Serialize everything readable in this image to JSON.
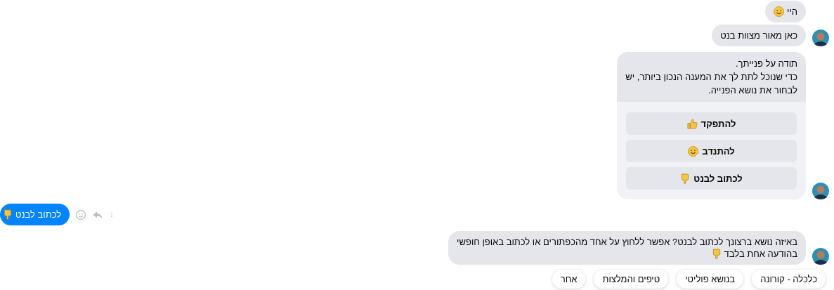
{
  "messages": [
    {
      "kind": "bot-text",
      "lines": [
        {
          "text": "היי",
          "kind": "smile"
        }
      ],
      "avatar": false
    },
    {
      "kind": "bot-text",
      "lines": [
        {
          "text": "כאן מאור מצוות בנט",
          "kind": "plain"
        }
      ],
      "avatar": true
    },
    {
      "kind": "bot-card",
      "paragraphs": [
        "תודה על פנייתך.",
        "כדי שנוכל לתת לך את המענה הנכון ביותר, יש לבחור את נושא הפנייה."
      ],
      "buttons": [
        {
          "label": "להתפקד",
          "kind": "thumbs-up"
        },
        {
          "label": "להתנדב",
          "kind": "smile"
        },
        {
          "label": "לכתוב לבנט",
          "kind": "point-down"
        }
      ],
      "avatar": true
    },
    {
      "kind": "user",
      "lines": [
        {
          "text": "לכתוב לבנט",
          "kind": "point-down"
        }
      ]
    },
    {
      "kind": "bot-text",
      "lines": [
        {
          "text": "באיזה נושא ברצונך לכתוב לבנט? אפשר ללחוץ על אחד מהכפתורים או לכתוב באופן חופשי",
          "kind": "plain"
        },
        {
          "text": "בהודעה אחת בלבד",
          "kind": "point-down"
        }
      ],
      "avatar": true
    }
  ],
  "quick_replies": [
    "כלכלה - קורונה",
    "בנושא פוליטי",
    "טיפים והמלצות",
    "אחר"
  ]
}
